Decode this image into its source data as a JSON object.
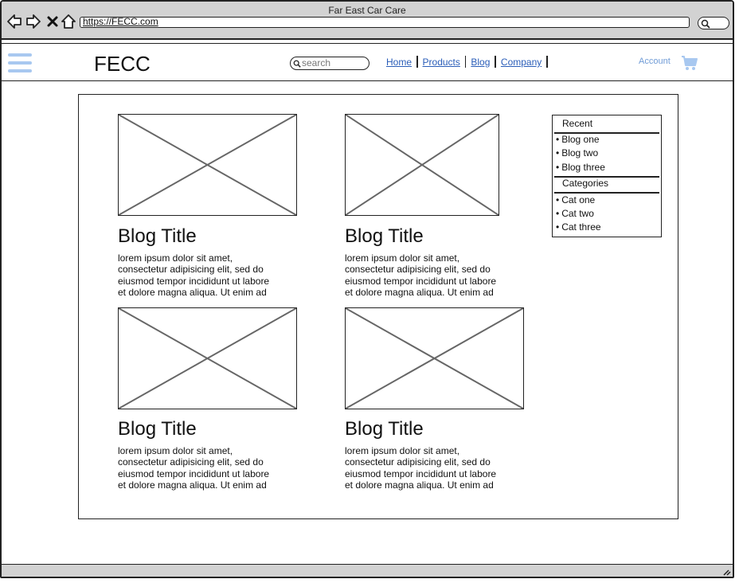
{
  "window": {
    "title": "Far East Car Care",
    "url": "https://FECC.com"
  },
  "header": {
    "brand": "FECC",
    "search_placeholder": "search",
    "nav": [
      "Home",
      "Products",
      "Blog",
      "Company"
    ],
    "account_label": "Account",
    "icons": [
      "menu-icon",
      "search-icon",
      "cart-icon"
    ]
  },
  "posts": [
    {
      "title": "Blog Title",
      "excerpt": [
        "lorem ipsum dolor sit amet,",
        "consectetur adipisicing elit, sed do",
        "eiusmod tempor incididunt ut labore",
        "et dolore magna aliqua. Ut enim ad"
      ]
    },
    {
      "title": "Blog Title",
      "excerpt": [
        "lorem ipsum dolor sit amet,",
        "consectetur adipisicing elit, sed do",
        "eiusmod tempor incididunt ut labore",
        "et dolore magna aliqua. Ut enim ad"
      ]
    },
    {
      "title": "Blog Title",
      "excerpt": [
        "lorem ipsum dolor sit amet,",
        "consectetur adipisicing elit, sed do",
        "eiusmod tempor incididunt ut labore",
        "et dolore magna aliqua. Ut enim ad"
      ]
    },
    {
      "title": "Blog Title",
      "excerpt": [
        "lorem ipsum dolor sit amet,",
        "consectetur adipisicing elit, sed do",
        "eiusmod tempor incididunt ut labore",
        "et dolore magna aliqua. Ut enim ad"
      ]
    }
  ],
  "sidebar": {
    "recent_heading": "Recent",
    "recent": [
      "Blog one",
      "Blog two",
      "Blog three"
    ],
    "categories_heading": "Categories",
    "categories": [
      "Cat one",
      "Cat two",
      "Cat three"
    ]
  },
  "colors": {
    "accent": "#2a5db8",
    "light_accent": "#a8c8f0",
    "chrome": "#d2d2d2"
  }
}
